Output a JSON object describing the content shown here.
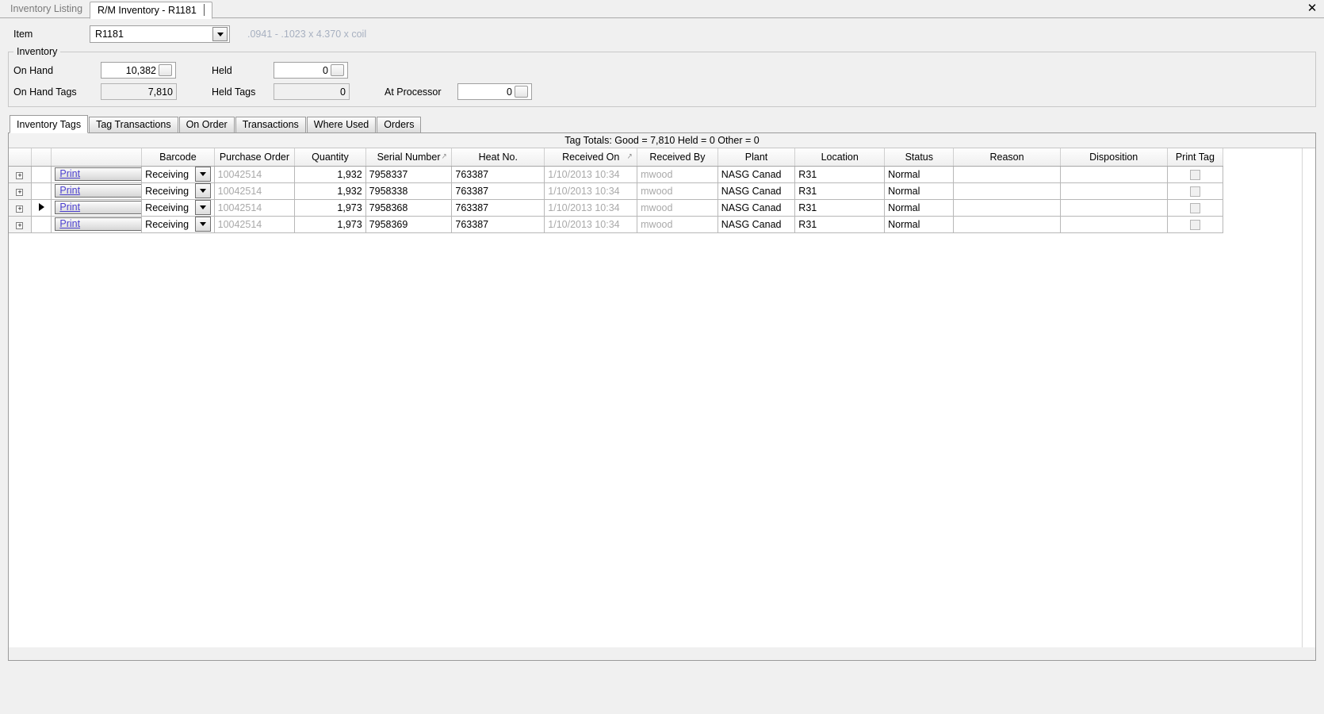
{
  "window": {
    "close_label": "✕"
  },
  "top_tabs": [
    {
      "label": "Inventory Listing",
      "active": false
    },
    {
      "label": "R/M Inventory - R1181",
      "active": true
    }
  ],
  "item": {
    "label": "Item",
    "value": "R1181",
    "description": ".0941 - .1023 x 4.370 x coil"
  },
  "inventory": {
    "title": "Inventory",
    "on_hand_label": "On Hand",
    "on_hand_value": "10,382",
    "held_label": "Held",
    "held_value": "0",
    "on_hand_tags_label": "On Hand Tags",
    "on_hand_tags_value": "7,810",
    "held_tags_label": "Held Tags",
    "held_tags_value": "0",
    "at_processor_label": "At Processor",
    "at_processor_value": "0"
  },
  "sub_tabs": [
    {
      "label": "Inventory Tags",
      "active": true
    },
    {
      "label": "Tag Transactions",
      "active": false
    },
    {
      "label": "On Order",
      "active": false
    },
    {
      "label": "Transactions",
      "active": false
    },
    {
      "label": "Where Used",
      "active": false
    },
    {
      "label": "Orders",
      "active": false
    }
  ],
  "tag_totals": "Tag Totals:  Good = 7,810 Held = 0 Other = 0",
  "grid": {
    "columns": [
      {
        "label": "",
        "key": "expander"
      },
      {
        "label": "",
        "key": "selector"
      },
      {
        "label": "",
        "key": "print"
      },
      {
        "label": "Barcode",
        "key": "barcode"
      },
      {
        "label": "Purchase Order",
        "key": "purchase_order"
      },
      {
        "label": "Quantity",
        "key": "quantity"
      },
      {
        "label": "Serial Number",
        "key": "serial_number",
        "sort": "↗"
      },
      {
        "label": "Heat No.",
        "key": "heat_no"
      },
      {
        "label": "Received On",
        "key": "received_on",
        "sort": "↗"
      },
      {
        "label": "Received By",
        "key": "received_by"
      },
      {
        "label": "Plant",
        "key": "plant"
      },
      {
        "label": "Location",
        "key": "location"
      },
      {
        "label": "Status",
        "key": "status"
      },
      {
        "label": "Reason",
        "key": "reason"
      },
      {
        "label": "Disposition",
        "key": "disposition"
      },
      {
        "label": "Print Tag",
        "key": "print_tag"
      }
    ],
    "expander_glyph": "+",
    "print_label": "Print",
    "rows": [
      {
        "selected": false,
        "barcode": "Receiving",
        "purchase_order": "10042514",
        "quantity": "1,932",
        "serial_number": "7958337",
        "heat_no": "763387",
        "received_on": "1/10/2013 10:34",
        "received_by": "mwood",
        "plant": "NASG Canad",
        "location": "R31",
        "status": "Normal",
        "reason": "",
        "disposition": "",
        "print_tag": false
      },
      {
        "selected": false,
        "barcode": "Receiving",
        "purchase_order": "10042514",
        "quantity": "1,932",
        "serial_number": "7958338",
        "heat_no": "763387",
        "received_on": "1/10/2013 10:34",
        "received_by": "mwood",
        "plant": "NASG Canad",
        "location": "R31",
        "status": "Normal",
        "reason": "",
        "disposition": "",
        "print_tag": false
      },
      {
        "selected": true,
        "barcode": "Receiving",
        "purchase_order": "10042514",
        "quantity": "1,973",
        "serial_number": "7958368",
        "heat_no": "763387",
        "received_on": "1/10/2013 10:34",
        "received_by": "mwood",
        "plant": "NASG Canad",
        "location": "R31",
        "status": "Normal",
        "reason": "",
        "disposition": "",
        "print_tag": false
      },
      {
        "selected": false,
        "barcode": "Receiving",
        "purchase_order": "10042514",
        "quantity": "1,973",
        "serial_number": "7958369",
        "heat_no": "763387",
        "received_on": "1/10/2013 10:34",
        "received_by": "mwood",
        "plant": "NASG Canad",
        "location": "R31",
        "status": "Normal",
        "reason": "",
        "disposition": "",
        "print_tag": false
      }
    ]
  },
  "colors": {
    "link": "#4b3fcf",
    "muted_text": "#a9a9a9",
    "item_description": "#a7b0c0",
    "window_bg": "#f0f0f0"
  }
}
